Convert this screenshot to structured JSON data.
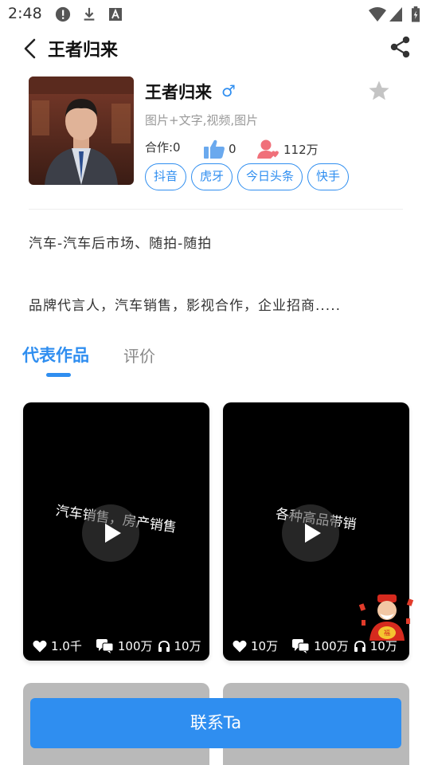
{
  "status_bar": {
    "time": "2:48",
    "icons": [
      "alert-icon",
      "download-icon",
      "a-icon",
      "wifi-icon",
      "signal-icon",
      "battery-icon"
    ]
  },
  "header": {
    "title": "王者归来",
    "back_icon": "back-arrow-icon",
    "share_icon": "share-icon"
  },
  "profile": {
    "name": "王者归来",
    "gender_symbol": "♂",
    "content_types": "图片+文字,视频,图片",
    "cooperation": "合作:0",
    "likes": "0",
    "fans": "112万",
    "favorite_icon": "star-icon",
    "platforms": [
      "抖音",
      "虎牙",
      "今日头条",
      "快手"
    ]
  },
  "description": {
    "category": "汽车-汽车后市场、随拍-随拍",
    "services": "品牌代言人，汽车销售，影视合作，企业招商....."
  },
  "tabs": {
    "works": "代表作品",
    "reviews": "评价"
  },
  "videos": [
    {
      "caption": "汽车销售，房产销售",
      "likes": "1.0千",
      "comments": "100万",
      "listens": "10万"
    },
    {
      "caption": "各种高品带销",
      "likes": "10万",
      "comments": "100万",
      "listens": "10万"
    }
  ],
  "contact_button": "联系Ta",
  "colors": {
    "accent": "#2f8ef0",
    "fans_icon": "#f0707a",
    "card_bg": "#000000",
    "placeholder_card": "#b9b9b9"
  }
}
